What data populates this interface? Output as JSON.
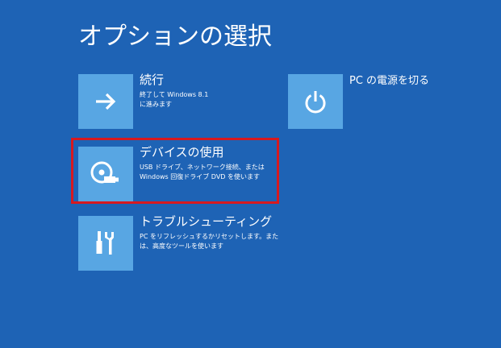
{
  "page": {
    "title": "オプションの選択"
  },
  "options": {
    "continue": {
      "title": "続行",
      "desc_line1": "終了して Windows 8.1",
      "desc_line2": "に進みます",
      "icon": "arrow-right-icon"
    },
    "device": {
      "title": "デバイスの使用",
      "desc_line1": "USB ドライブ、ネットワーク接続、または",
      "desc_line2": "Windows 回復ドライブ DVD を使います",
      "icon": "disc-usb-icon"
    },
    "troubleshoot": {
      "title": "トラブルシューティング",
      "desc_line1": "PC をリフレッシュするかリセットします。また",
      "desc_line2": "は、高度なツールを使います",
      "icon": "tools-icon"
    },
    "power": {
      "title": "PC の電源を切る",
      "icon": "power-icon"
    }
  },
  "colors": {
    "background": "#1e63b5",
    "tile": "#58a6e3",
    "highlight": "#d7191f"
  }
}
